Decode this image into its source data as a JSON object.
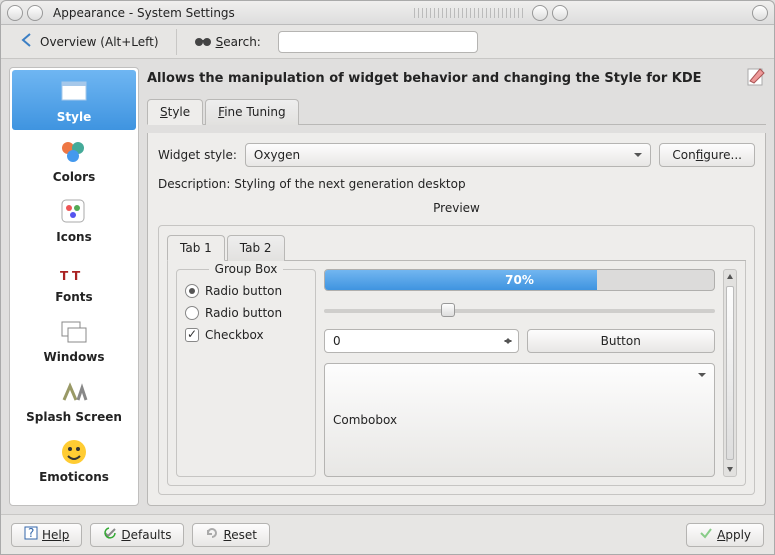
{
  "window": {
    "title": "Appearance - System Settings"
  },
  "toolbar": {
    "overview_label": "Overview (Alt+Left)",
    "search_label": "Search:"
  },
  "sidebar": {
    "items": [
      {
        "label": "Style"
      },
      {
        "label": "Colors"
      },
      {
        "label": "Icons"
      },
      {
        "label": "Fonts"
      },
      {
        "label": "Windows"
      },
      {
        "label": "Splash Screen"
      },
      {
        "label": "Emoticons"
      }
    ],
    "selected": 0
  },
  "header": {
    "title": "Allows the manipulation of widget behavior and changing the Style for KDE"
  },
  "tabs": [
    {
      "label": "Style"
    },
    {
      "label": "Fine Tuning"
    }
  ],
  "style_panel": {
    "widget_style_label": "Widget style:",
    "widget_style_value": "Oxygen",
    "configure_label": "Configure...",
    "description_label": "Description: Styling of the next generation desktop",
    "preview_label": "Preview"
  },
  "preview": {
    "tabs": [
      {
        "label": "Tab 1"
      },
      {
        "label": "Tab 2"
      }
    ],
    "groupbox_title": "Group Box",
    "radio1_label": "Radio button",
    "radio2_label": "Radio button",
    "checkbox_label": "Checkbox",
    "progress_percent": "70%",
    "spinbox_value": "0",
    "button_label": "Button",
    "combobox_value": "Combobox"
  },
  "footer": {
    "help_label": "Help",
    "defaults_label": "Defaults",
    "reset_label": "Reset",
    "apply_label": "Apply"
  }
}
